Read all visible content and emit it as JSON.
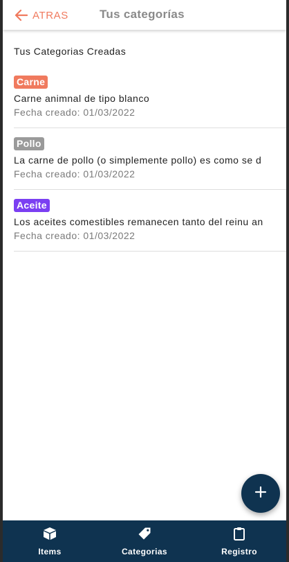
{
  "header": {
    "back_label": "ATRAS",
    "title": "Tus categorías"
  },
  "section_title": "Tus Categorias Creadas",
  "categories": [
    {
      "name": "Carne",
      "color": "#f07a5e",
      "description": "Carne animnal de tipo blanco",
      "date": "Fecha creado: 01/03/2022"
    },
    {
      "name": "Pollo",
      "color": "#9a9a9a",
      "description": "La carne de pollo (o simplemente pollo) es como se d",
      "date": "Fecha creado: 01/03/2022"
    },
    {
      "name": "Aceite",
      "color": "#7b3ff2",
      "description": "Los aceites comestibles remanecen tanto del reinu an",
      "date": "Fecha creado: 01/03/2022"
    }
  ],
  "fab": {
    "icon": "plus-icon"
  },
  "bottom_nav": {
    "items": [
      {
        "label": "Items",
        "icon": "cube-icon"
      },
      {
        "label": "Categorias",
        "icon": "tag-icon"
      },
      {
        "label": "Registro",
        "icon": "clipboard-icon"
      }
    ]
  },
  "colors": {
    "accent": "#f07a5e",
    "primary": "#0f3350"
  }
}
